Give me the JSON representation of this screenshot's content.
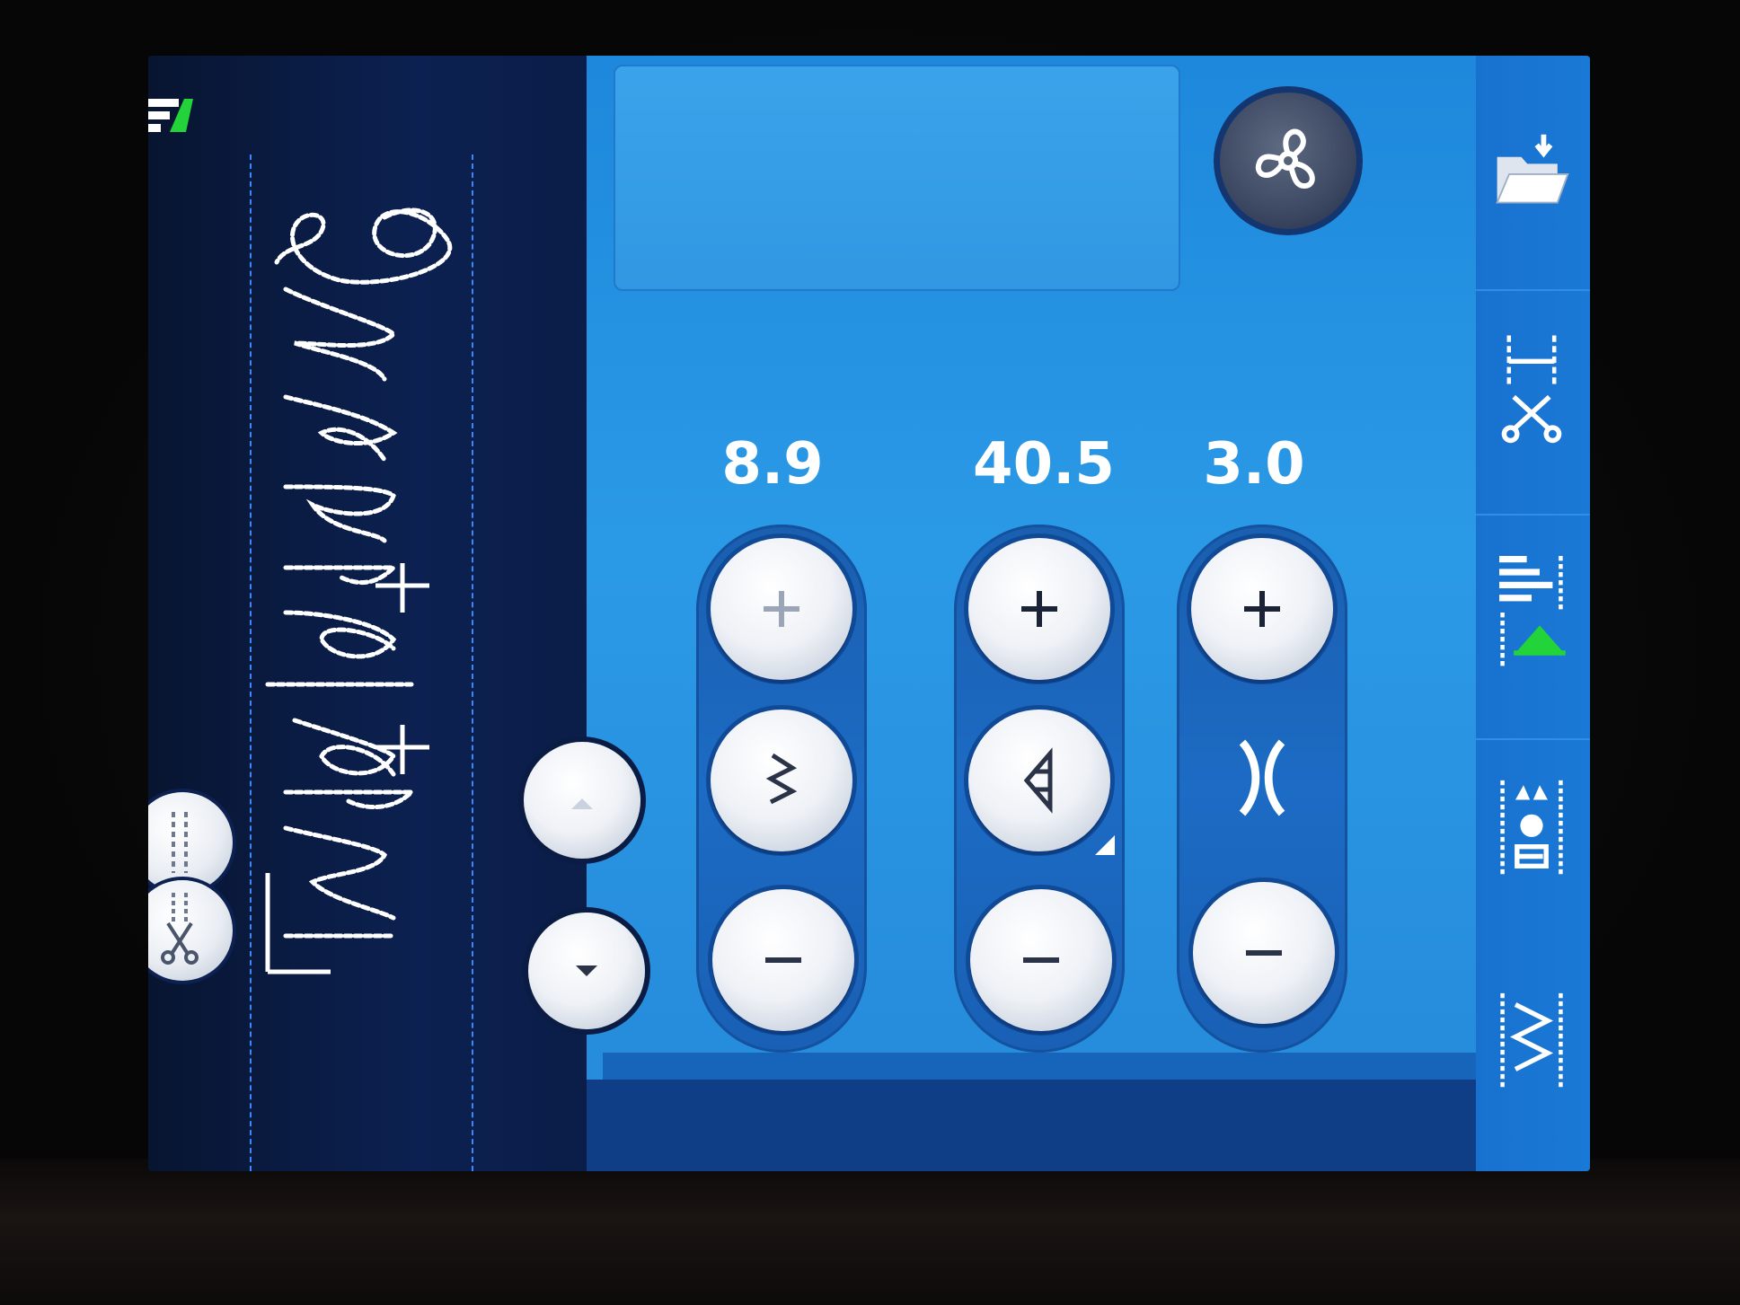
{
  "stitch_settings": {
    "width": {
      "value": "8.9",
      "increase_symbol": "+",
      "decrease_symbol": "−",
      "icon": "zigzag-icon"
    },
    "length": {
      "value": "40.5",
      "increase_symbol": "+",
      "decrease_symbol": "−",
      "icon": "stitch-length-icon"
    },
    "density": {
      "value": "3.0",
      "increase_symbol": "+",
      "decrease_symbol": "−",
      "icon": "density-icon"
    }
  },
  "left_controls": {
    "scroll_up_icon": "triangle-up-icon",
    "scroll_down_icon": "triangle-down-icon",
    "tie_off_icons": [
      "tie-off-start-icon",
      "tie-off-cut-icon"
    ]
  },
  "top_controls": {
    "fan_icon": "fan-icon"
  },
  "right_toolbar": [
    "load-folder-icon",
    "program-cut-icon",
    "balance-icon",
    "sequence-text-icon",
    "stitch-options-icon"
  ],
  "colors": {
    "panel": "#2b9ae6",
    "preview_background": "#0c2151",
    "rail": "#1a79d6",
    "value_text": "#ffffff",
    "green_accent": "#22d33a"
  }
}
